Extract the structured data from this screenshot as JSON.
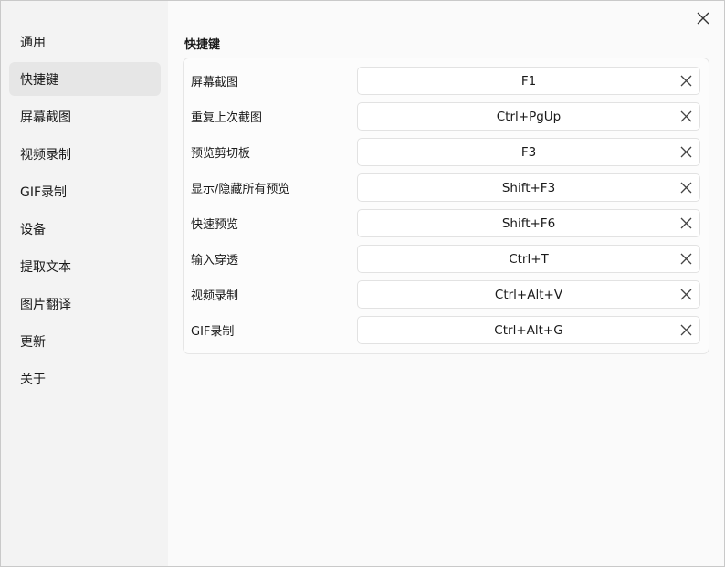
{
  "sidebar": {
    "items": [
      {
        "label": "通用"
      },
      {
        "label": "快捷键"
      },
      {
        "label": "屏幕截图"
      },
      {
        "label": "视频录制"
      },
      {
        "label": "GIF录制"
      },
      {
        "label": "设备"
      },
      {
        "label": "提取文本"
      },
      {
        "label": "图片翻译"
      },
      {
        "label": "更新"
      },
      {
        "label": "关于"
      }
    ],
    "active_index": 1
  },
  "main": {
    "title": "快捷键",
    "shortcuts": [
      {
        "label": "屏幕截图",
        "key": "F1"
      },
      {
        "label": "重复上次截图",
        "key": "Ctrl+PgUp"
      },
      {
        "label": "预览剪切板",
        "key": "F3"
      },
      {
        "label": "显示/隐藏所有预览",
        "key": "Shift+F3"
      },
      {
        "label": "快速预览",
        "key": "Shift+F6"
      },
      {
        "label": "输入穿透",
        "key": "Ctrl+T"
      },
      {
        "label": "视频录制",
        "key": "Ctrl+Alt+V"
      },
      {
        "label": "GIF录制",
        "key": "Ctrl+Alt+G"
      }
    ]
  },
  "icons": {
    "close": "close-icon",
    "clear": "clear-icon"
  }
}
